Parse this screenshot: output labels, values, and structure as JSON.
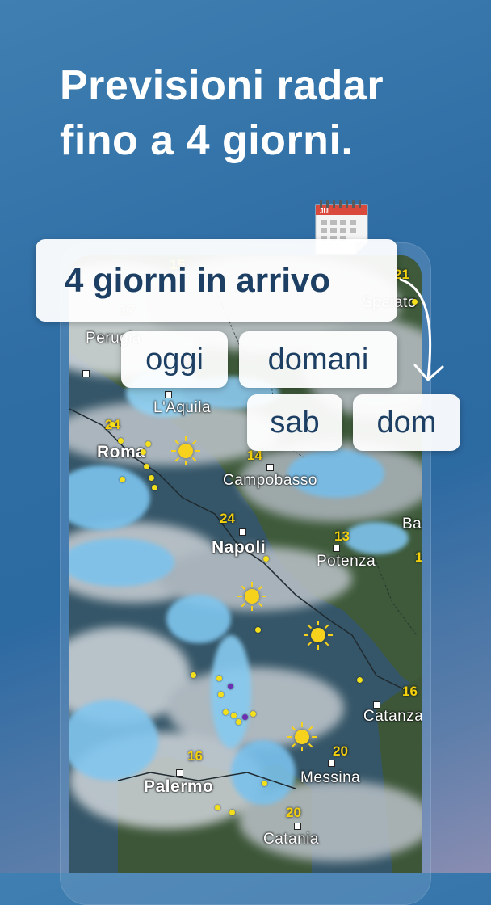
{
  "headline": {
    "line1": "Previsioni radar",
    "line2": "fino a 4 giorni."
  },
  "overlay": {
    "main_chip": "4 giorni in arrivo",
    "days": [
      "oggi",
      "domani",
      "sab",
      "dom"
    ],
    "calendar_icon": "calendar-icon",
    "calendar_month": "JUL"
  },
  "map": {
    "cities": [
      {
        "name": "Perugia"
      },
      {
        "name": "L'Aquila"
      },
      {
        "name": "Roma"
      },
      {
        "name": "Campobasso"
      },
      {
        "name": "Napoli"
      },
      {
        "name": "Potenza"
      },
      {
        "name": "Catanza"
      },
      {
        "name": "Palermo"
      },
      {
        "name": "Messina"
      },
      {
        "name": "Catania"
      },
      {
        "name": "Spalato"
      },
      {
        "name": "Ba"
      }
    ],
    "temperatures": [
      "15",
      "17",
      "21",
      "24",
      "14",
      "24",
      "13",
      "16",
      "16",
      "20",
      "20",
      "1"
    ]
  },
  "colors": {
    "headline": "#ffffff",
    "chip_text": "#1c3f63",
    "temperature": "#f5d10c",
    "rain": "#7cc4ef"
  }
}
